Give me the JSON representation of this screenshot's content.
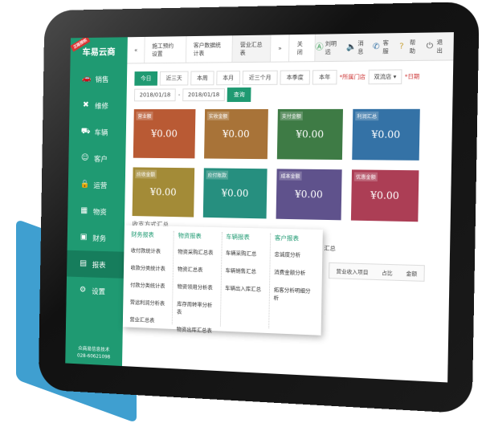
{
  "app": {
    "logo": "车易云商",
    "badge": "正版授权"
  },
  "sidebar": {
    "items": [
      {
        "label": "销售",
        "icon": "car-icon"
      },
      {
        "label": "维修",
        "icon": "wrench-icon"
      },
      {
        "label": "车辆",
        "icon": "vehicle-icon"
      },
      {
        "label": "客户",
        "icon": "user-icon"
      },
      {
        "label": "运营",
        "icon": "lock-icon"
      },
      {
        "label": "物资",
        "icon": "warehouse-icon"
      },
      {
        "label": "财务",
        "icon": "finance-icon"
      },
      {
        "label": "报表",
        "icon": "report-icon",
        "active": true
      },
      {
        "label": "设置",
        "icon": "gear-icon"
      }
    ],
    "footer_line1": "众商易信息技术",
    "footer_line2": "028-60621098"
  },
  "tabs": {
    "back": "«",
    "items": [
      "施工预约设置",
      "客户数据统计表",
      "营业汇总表"
    ],
    "active": 2,
    "forward": "»",
    "close": "关闭"
  },
  "toolbar": [
    {
      "label": "刘明远",
      "icon": "user-circle-icon"
    },
    {
      "label": "消息",
      "icon": "speaker-icon"
    },
    {
      "label": "客服",
      "icon": "phone-icon"
    },
    {
      "label": "帮助",
      "icon": "help-icon"
    },
    {
      "label": "退出",
      "icon": "power-icon"
    }
  ],
  "filters": {
    "buttons": [
      "今日",
      "近三天",
      "本周",
      "本月",
      "近三个月",
      "本季度",
      "本年"
    ],
    "active": 0,
    "store_label": "*所属门店",
    "store_value": "双流店",
    "date_label": "*日期",
    "date_from": "2018/01/18",
    "date_sep": "-",
    "date_to": "2018/01/18",
    "query": "查询"
  },
  "tiles": [
    {
      "label": "营业额",
      "value": "¥0.00",
      "color": "#b95a34"
    },
    {
      "label": "实收金额",
      "value": "¥0.00",
      "color": "#a87338"
    },
    {
      "label": "支付金额",
      "value": "¥0.00",
      "color": "#3e7b45"
    },
    {
      "label": "利润汇总",
      "value": "¥0.00",
      "color": "#3472a6"
    },
    {
      "label": "应收金额",
      "value": "¥0.00",
      "color": "#a38b37"
    },
    {
      "label": "应付账款",
      "value": "¥0.00",
      "color": "#268f7f"
    },
    {
      "label": "成本金额",
      "value": "¥0.00",
      "color": "#5f528c"
    },
    {
      "label": "优惠金额",
      "value": "¥0.00",
      "color": "#ac3e55"
    }
  ],
  "section_title": "收支方式汇总",
  "right_summary": "汇总",
  "summary_row": [
    "营业收入项目",
    "占比",
    "金额"
  ],
  "menu": [
    {
      "title": "财务报表",
      "items": [
        "收付款统计表",
        "收款分类统计表",
        "付款分类统计表",
        "营运利润分析表",
        "营业汇总表"
      ]
    },
    {
      "title": "物资报表",
      "items": [
        "物资采购汇总表",
        "物资汇总表",
        "物资领用分析表",
        "库存周转率分析表",
        "物资出库汇总表"
      ]
    },
    {
      "title": "车辆报表",
      "items": [
        "车辆采购汇总",
        "车辆销售汇总",
        "车辆出入库汇总"
      ]
    },
    {
      "title": "客户报表",
      "items": [
        "忠诚度分析",
        "消费金额分析",
        "拓客分析明细分析"
      ]
    }
  ]
}
